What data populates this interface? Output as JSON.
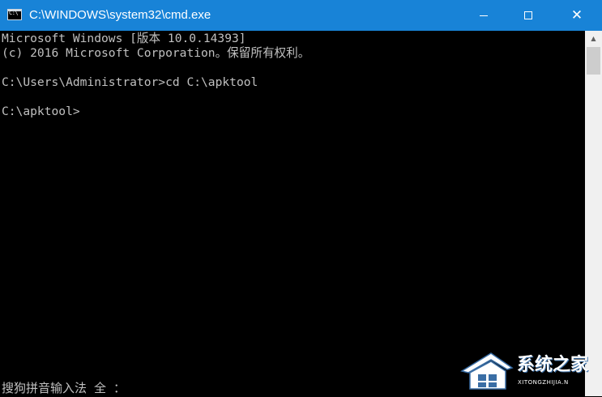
{
  "window": {
    "title": "C:\\WINDOWS\\system32\\cmd.exe",
    "icon_label": "C:\\",
    "icon": "cmd-icon",
    "buttons": {
      "minimize_icon": "minimize-icon",
      "maximize_icon": "maximize-icon",
      "close_icon": "close-icon"
    },
    "colors": {
      "titlebar": "#1883d7",
      "console_bg": "#000000",
      "console_text": "#c0c0c0"
    }
  },
  "console": {
    "lines": [
      "Microsoft Windows [版本 10.0.14393]",
      "(c) 2016 Microsoft Corporation。保留所有权利。",
      "",
      "C:\\Users\\Administrator>cd C:\\apktool",
      "",
      "C:\\apktool>"
    ]
  },
  "ime": {
    "status": "搜狗拼音输入法 全 ："
  },
  "watermark": {
    "title": "系统之家",
    "subtitle": "XITONGZHIJIA.N"
  }
}
